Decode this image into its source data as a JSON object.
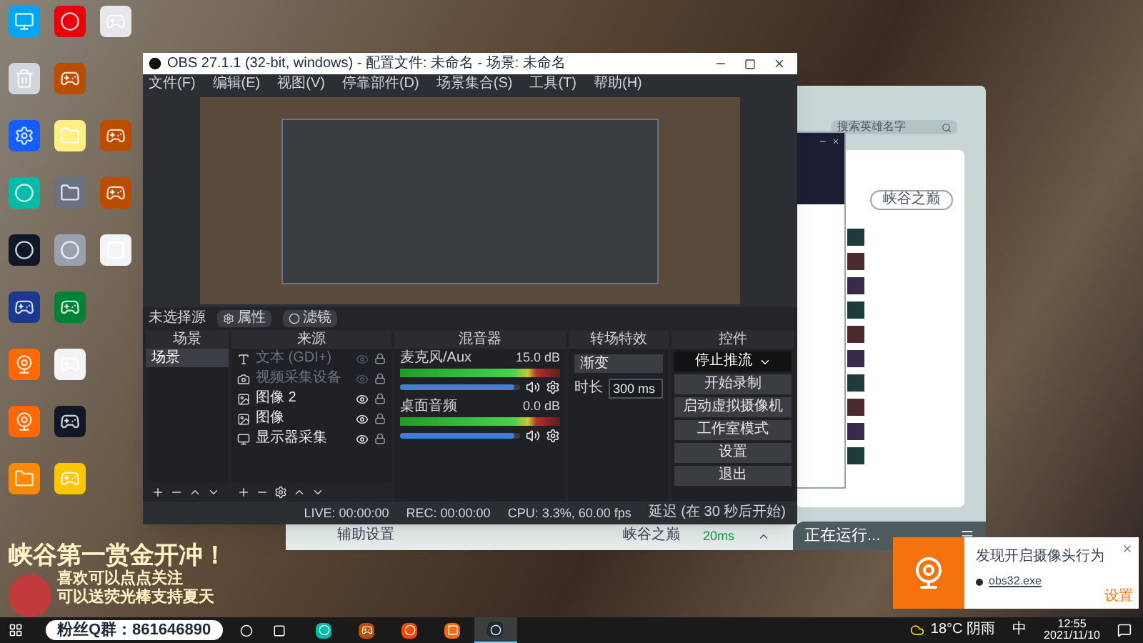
{
  "obs": {
    "title": "OBS 27.1.1 (32-bit, windows) - 配置文件: 未命名 - 场景: 未命名",
    "menu": [
      "文件(F)",
      "编辑(E)",
      "视图(V)",
      "停靠部件(D)",
      "场景集合(S)",
      "工具(T)",
      "帮助(H)"
    ],
    "source_bar": {
      "label": "未选择源",
      "buttons": [
        "属性",
        "滤镜"
      ]
    },
    "scenes": {
      "title": "场景",
      "items": [
        {
          "label": "场景",
          "selected": true
        }
      ]
    },
    "sources": {
      "title": "来源",
      "items": [
        {
          "label": "文本 (GDI+)",
          "kind": "text",
          "visible": false
        },
        {
          "label": "视频采集设备",
          "kind": "camera",
          "visible": false
        },
        {
          "label": "图像 2",
          "kind": "image",
          "visible": true
        },
        {
          "label": "图像",
          "kind": "image",
          "visible": true
        },
        {
          "label": "显示器采集",
          "kind": "monitor",
          "visible": true
        }
      ]
    },
    "mixer": {
      "title": "混音器",
      "channels": [
        {
          "name": "麦克风/Aux",
          "reading": "15.0 dB",
          "level": 0.95
        },
        {
          "name": "桌面音频",
          "reading": "0.0 dB",
          "level": 0.95
        }
      ]
    },
    "transitions": {
      "title": "转场特效",
      "type": "渐变",
      "duration_label": "时长",
      "duration": "300 ms"
    },
    "controls": {
      "title": "控件",
      "buttons": [
        {
          "label": "停止推流",
          "kind": "dropdown"
        },
        {
          "label": "开始录制",
          "kind": "button"
        },
        {
          "label": "启动虚拟摄像机",
          "kind": "button"
        },
        {
          "label": "工作室模式",
          "kind": "button"
        },
        {
          "label": "设置",
          "kind": "button"
        },
        {
          "label": "退出",
          "kind": "button"
        }
      ]
    },
    "status": {
      "live": "LIVE: 00:00:00",
      "rec": "REC: 00:00:00",
      "cpu": "CPU: 3.3%, 60.00 fps",
      "delay": "延迟 (在 30 秒后开始)"
    }
  },
  "game_app": {
    "search": {
      "placeholder": "搜索英雄名字"
    },
    "server_select": "峡谷之巅",
    "bottom": {
      "assist": "辅助设置",
      "server": "峡谷之巅",
      "ping": "20ms",
      "running": "正在运行..."
    }
  },
  "overlay": {
    "headline": "峡谷第一赏金开冲！",
    "lines": [
      "喜欢可以点点关注",
      "可以送荧光棒支持夏天"
    ],
    "group": "粉丝Q群：861646890"
  },
  "notification": {
    "title": "发现开启摄像头行为",
    "process": "obs32.exe",
    "settings": "设置"
  },
  "taskbar": {
    "apps": [
      {
        "kind": "edge",
        "selected": false
      },
      {
        "kind": "game",
        "selected": false
      },
      {
        "kind": "g",
        "selected": false
      },
      {
        "kind": "orange",
        "selected": false
      },
      {
        "kind": "obs",
        "selected": true
      }
    ],
    "weather": "18°C 阴雨",
    "ime": "中",
    "time": "12:55",
    "date": "2021/11/10"
  }
}
